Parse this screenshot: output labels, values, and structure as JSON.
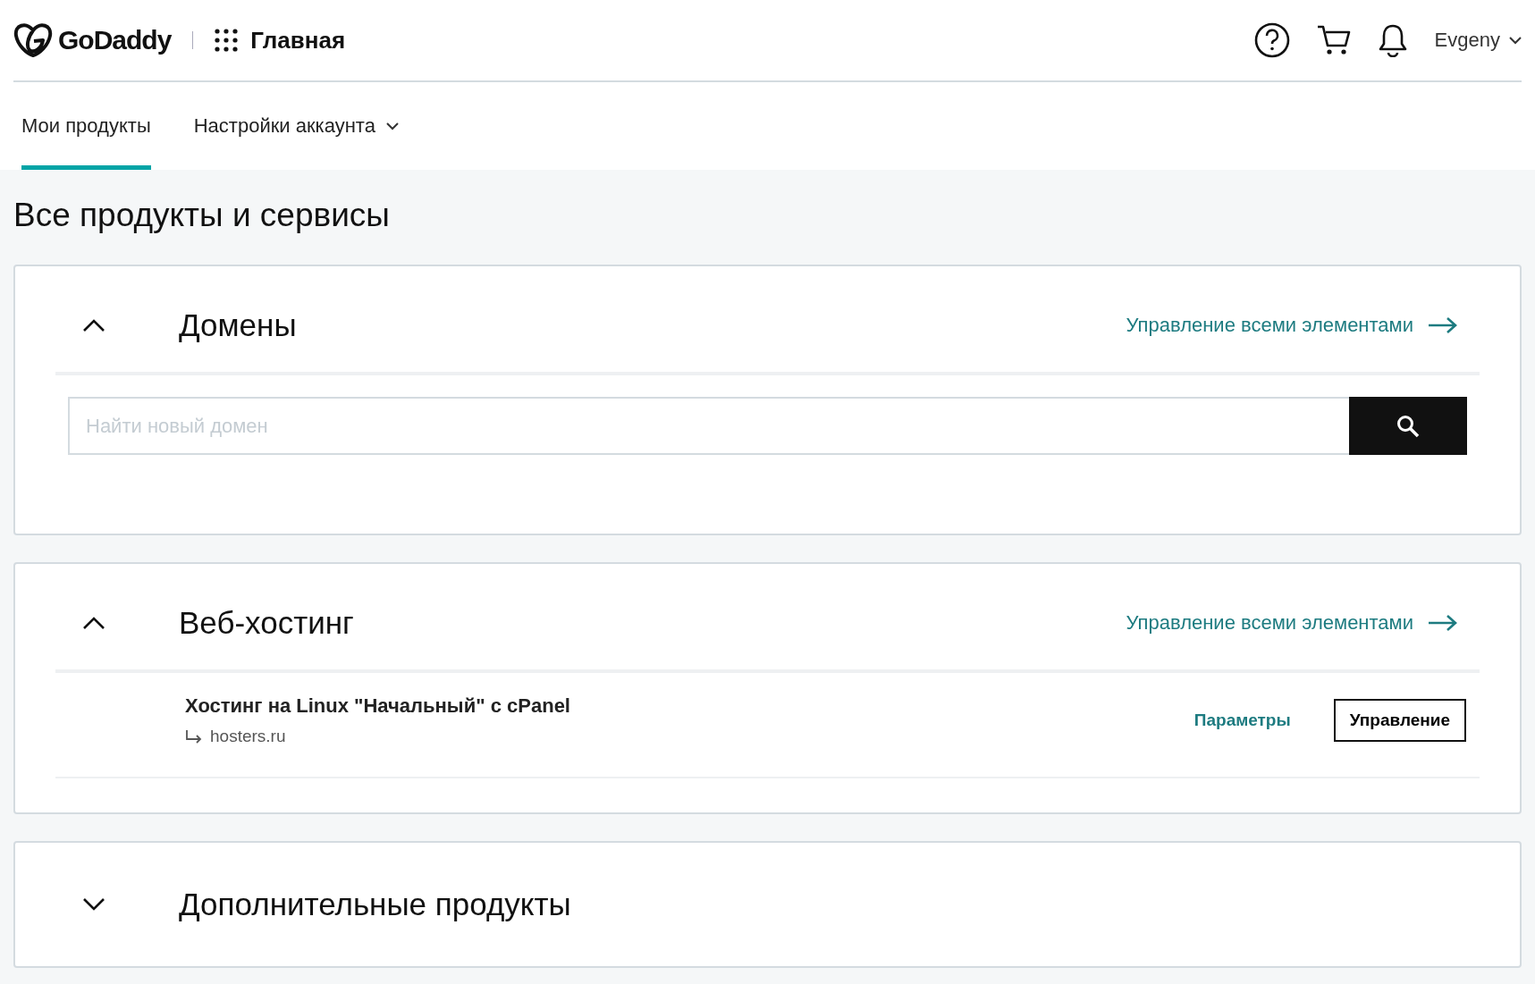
{
  "header": {
    "logo": "GoDaddy",
    "nav_title": "Главная",
    "user": "Evgeny"
  },
  "tabs": [
    {
      "label": "Мои продукты",
      "selected": true,
      "dropdown": false
    },
    {
      "label": "Настройки аккаунта",
      "selected": false,
      "dropdown": true
    }
  ],
  "page_title": "Все продукты и сервисы",
  "sections": [
    {
      "title": "Домены",
      "expanded": true,
      "manage_link": "Управление всеми элементами",
      "search": {
        "placeholder": "Найти новый домен"
      }
    },
    {
      "title": "Веб-хостинг",
      "expanded": true,
      "manage_link": "Управление всеми элементами",
      "products": [
        {
          "name": "Хостинг на Linux \"Начальный\" с cPanel",
          "domain": "hosters.ru",
          "settings_link": "Параметры",
          "manage_button": "Управление"
        }
      ]
    },
    {
      "title": "Дополнительные продукты",
      "expanded": false
    }
  ]
}
